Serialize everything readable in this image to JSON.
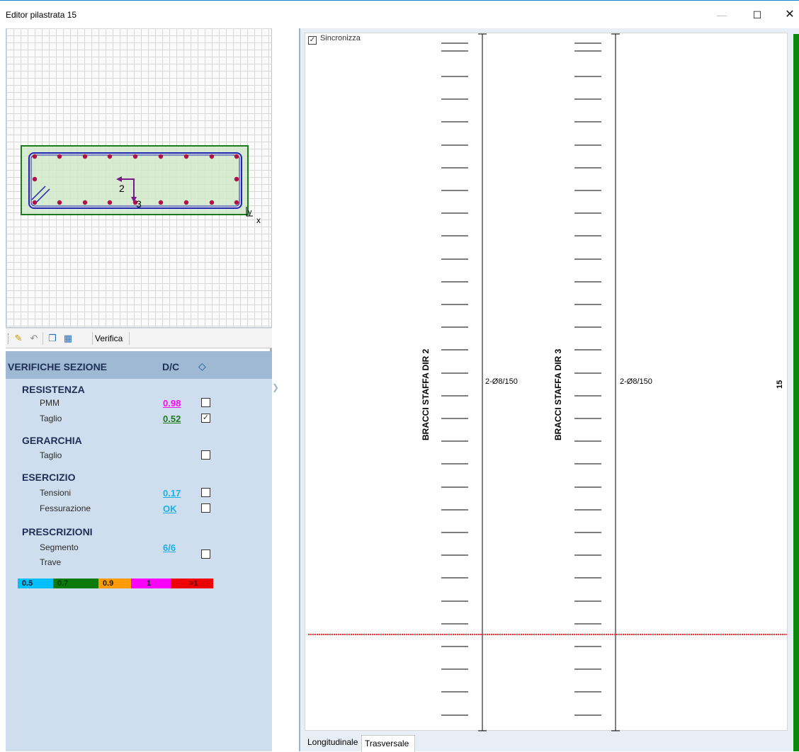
{
  "window": {
    "title": "Editor pilastrata 15",
    "min_glyph": "—",
    "max_glyph": "☐",
    "close_glyph": "✕"
  },
  "toolbar": {
    "verifica_label": "Verifica"
  },
  "section": {
    "axis_2": "2",
    "axis_3": "3",
    "axis_x": "x",
    "axis_y": "y"
  },
  "checks": {
    "header": "VERIFICHE SEZIONE",
    "dc_label": "D/C",
    "eye_glyph": "👁",
    "groups": [
      {
        "title": "RESISTENZA",
        "rows": [
          {
            "label": "PMM",
            "value": "0.98",
            "color": "#ff00ff",
            "checked": false
          },
          {
            "label": "Taglio",
            "value": "0.52",
            "color": "#1a7a1a",
            "checked": true
          }
        ]
      },
      {
        "title": "GERARCHIA",
        "rows": [
          {
            "label": "Taglio",
            "value": "",
            "color": "",
            "checked": false
          }
        ]
      },
      {
        "title": "ESERCIZIO",
        "rows": [
          {
            "label": "Tensioni",
            "value": "0.17",
            "color": "#1ab0e8",
            "checked": false
          },
          {
            "label": "Fessurazione",
            "value": "OK",
            "color": "#1ab0e8",
            "checked": false
          }
        ]
      },
      {
        "title": "PRESCRIZIONI",
        "rows": [
          {
            "label": "Segmento",
            "value": "6/6",
            "color": "#1ab0e8",
            "checked": false
          },
          {
            "label": "Trave",
            "value": "",
            "color": "",
            "checked": false
          }
        ]
      }
    ],
    "legend": [
      {
        "label": "0.5",
        "color": "#00bfff"
      },
      {
        "label": "0.7",
        "color": "#0a7a0a"
      },
      {
        "label": "0.9",
        "color": "#ff9a00"
      },
      {
        "label": "1",
        "color": "#ff00ff"
      },
      {
        "label": ">1",
        "color": "#ee0000"
      }
    ]
  },
  "drawing": {
    "sync_label": "Sincronizza",
    "col1_label": "BRACCI STAFFA DIR 2",
    "col2_label": "BRACCI STAFFA DIR 3",
    "spacing1": "2-Ø8/150",
    "spacing2": "2-Ø8/150",
    "level": "15"
  },
  "tabs": {
    "longitudinal": "Longitudinale",
    "transverse": "Trasversale"
  }
}
